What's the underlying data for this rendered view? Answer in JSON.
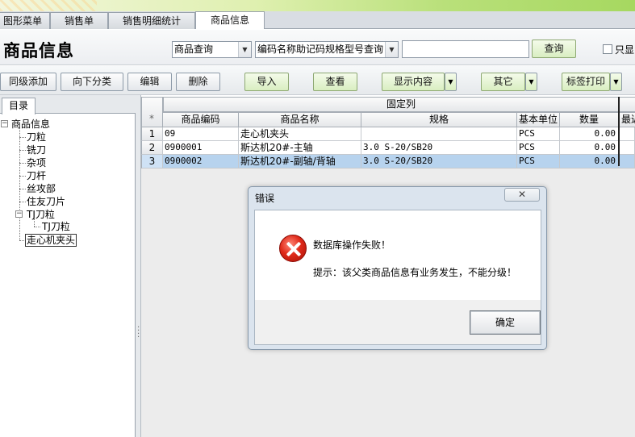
{
  "tabs": [
    {
      "label": "图形菜单"
    },
    {
      "label": "销售单"
    },
    {
      "label": "销售明细统计"
    },
    {
      "label": "商品信息"
    }
  ],
  "header": {
    "title": "商品信息",
    "query_type": "商品查询",
    "query_fields": "编码名称助记码规格型号查询",
    "search_value": "",
    "query_button": "查询",
    "only_show_label": "只显"
  },
  "toolbar": {
    "add_same_level": "同级添加",
    "add_subcategory": "向下分类",
    "edit": "编辑",
    "delete": "删除",
    "import": "导入",
    "view": "查看",
    "show_content": "显示内容",
    "other": "其它",
    "label_print": "标签打印"
  },
  "tree": {
    "tab_label": "目录",
    "root": "商品信息",
    "items": [
      "刀粒",
      "铣刀",
      "杂项",
      "刀杆",
      "丝攻部",
      "住友刀片",
      "TJ刀粒",
      "走心机夹头"
    ],
    "child_of_tj": "TJ刀粒",
    "selected": "走心机夹头"
  },
  "grid": {
    "fixed_header": "固定列",
    "corner": "*",
    "columns": [
      "商品编码",
      "商品名称",
      "规格",
      "基本单位",
      "数量",
      "最近"
    ],
    "rows": [
      {
        "num": "1",
        "code": "09",
        "name": "走心机夹头",
        "spec": "",
        "unit": "PCS",
        "qty": "0.00"
      },
      {
        "num": "2",
        "code": "0900001",
        "name": "斯达机20#-主轴",
        "spec": "3.0 S-20/SB20",
        "unit": "PCS",
        "qty": "0.00"
      },
      {
        "num": "3",
        "code": "0900002",
        "name": "斯达机20#-副轴/背轴",
        "spec": "3.0 S-20/SB20",
        "unit": "PCS",
        "qty": "0.00"
      }
    ],
    "selected_row": 3
  },
  "dialog": {
    "title": "错误",
    "close": "✕",
    "icon": "error-icon",
    "message": "数据库操作失败！",
    "hint": "提示：该父类商品信息有业务发生，不能分级！",
    "ok": "确定"
  },
  "colors": {
    "selected_row": "#b7d3ee",
    "dialog_frame": "#dbe4ee",
    "error_red": "#e02a1a"
  }
}
